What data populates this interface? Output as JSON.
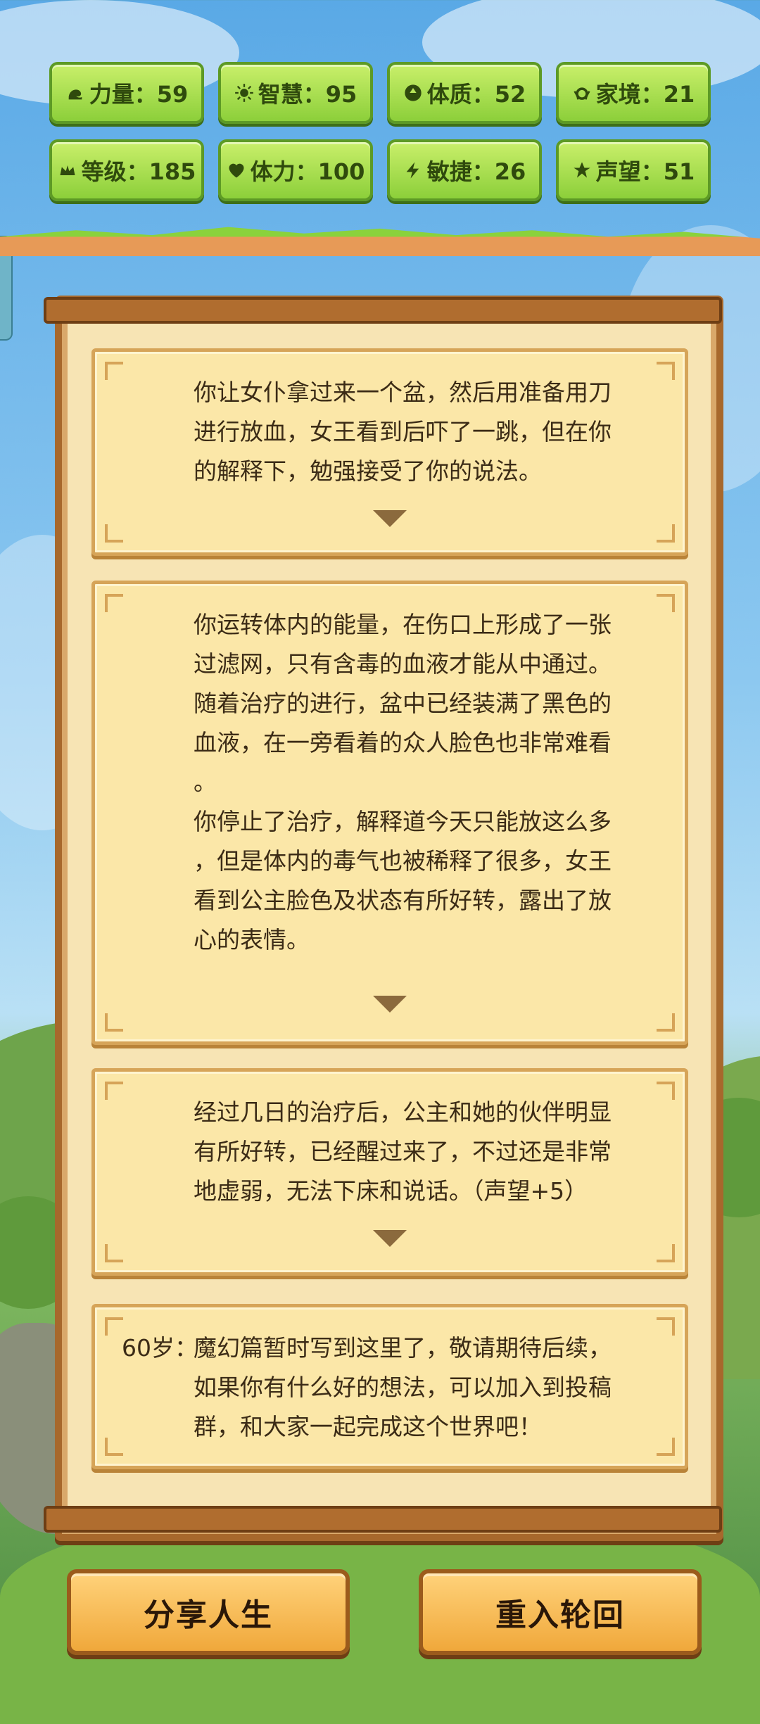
{
  "stats": [
    {
      "icon": "strength-icon",
      "label": "力量：59"
    },
    {
      "icon": "wisdom-icon",
      "label": "智慧：95"
    },
    {
      "icon": "constitution-icon",
      "label": "体质：52"
    },
    {
      "icon": "family-icon",
      "label": "家境：21"
    },
    {
      "icon": "crown-icon",
      "label": "等级：185"
    },
    {
      "icon": "heart-icon",
      "label": "体力：100"
    },
    {
      "icon": "lightning-icon",
      "label": "敏捷：26"
    },
    {
      "icon": "star-icon",
      "label": "声望：51"
    }
  ],
  "cards": [
    {
      "text": "你让女仆拿过来一个盆，然后用准备用刀\n进行放血，女王看到后吓了一跳，但在你\n的解释下，勉强接受了你的说法。"
    },
    {
      "text": "你运转体内的能量，在伤口上形成了一张\n过滤网，只有含毒的血液才能从中通过。\n随着治疗的进行，盆中已经装满了黑色的\n血液，在一旁看着的众人脸色也非常难看\n。\n你停止了治疗，解释道今天只能放这么多\n，但是体内的毒气也被稀释了很多，女王\n看到公主脸色及状态有所好转，露出了放\n心的表情。"
    },
    {
      "text": "经过几日的治疗后，公主和她的伙伴明显\n有所好转，已经醒过来了，不过还是非常\n地虚弱，无法下床和说话。（声望+5）"
    },
    {
      "age": "60岁：",
      "text": "魔幻篇暂时写到这里了，敬请期待后续，\n如果你有什么好的想法，可以加入到投稿\n群，和大家一起完成这个世界吧！"
    }
  ],
  "buttons": {
    "share": "分享人生",
    "restart": "重入轮回"
  }
}
